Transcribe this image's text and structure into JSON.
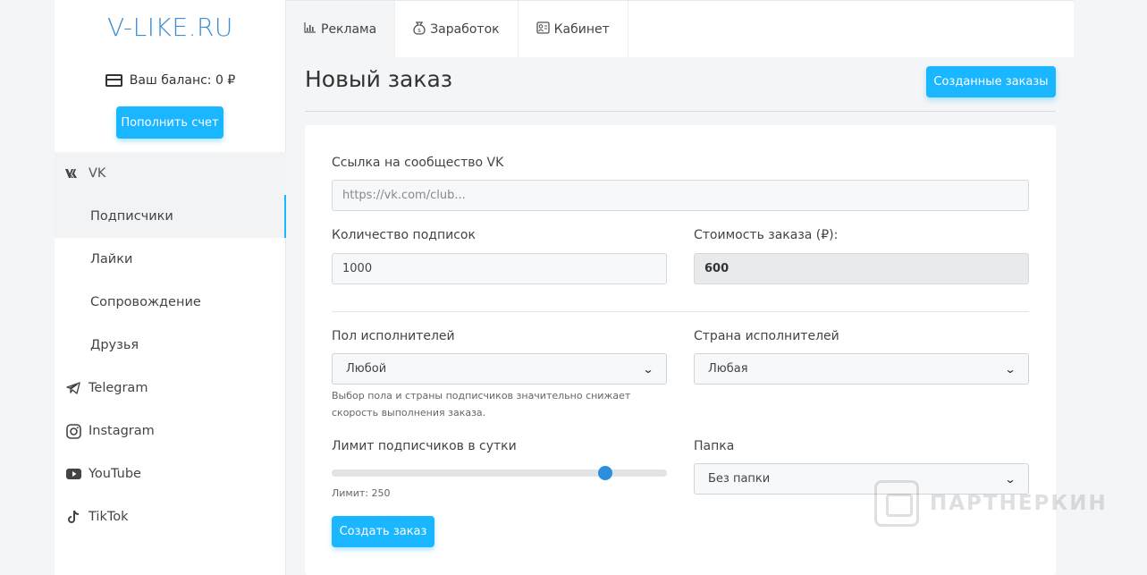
{
  "brand": {
    "logo": "V-LIKE.RU",
    "color": "#3e8ed0",
    "accent": "#1ab6ff"
  },
  "sidebar": {
    "balance_label": "Ваш баланс: 0 ₽",
    "balance_icon": "credit-card-icon",
    "topup_label": "Пополнить счет",
    "items": [
      {
        "label": "VK",
        "icon": "vk-icon",
        "type": "section"
      },
      {
        "label": "Подписчики",
        "type": "sub",
        "active": true
      },
      {
        "label": "Лайки",
        "type": "sub"
      },
      {
        "label": "Сопровождение",
        "type": "sub"
      },
      {
        "label": "Друзья",
        "type": "sub"
      },
      {
        "label": "Telegram",
        "icon": "telegram-icon",
        "type": "section"
      },
      {
        "label": "Instagram",
        "icon": "instagram-icon",
        "type": "section"
      },
      {
        "label": "YouTube",
        "icon": "youtube-icon",
        "type": "section"
      },
      {
        "label": "TikTok",
        "icon": "tiktok-icon",
        "type": "section"
      }
    ]
  },
  "topbar": {
    "tabs": [
      {
        "label": "Реклама",
        "icon": "bar-chart-icon",
        "active": true
      },
      {
        "label": "Заработок",
        "icon": "money-bag-icon"
      },
      {
        "label": "Кабинет",
        "icon": "cabinet-icon"
      }
    ]
  },
  "page": {
    "title": "Новый заказ",
    "orders_button": "Созданные заказы"
  },
  "form": {
    "link_label": "Ссылка на сообщество VK",
    "link_placeholder": "https://vk.com/club...",
    "link_value": "",
    "count_label": "Количество подписок",
    "count_value": "1000",
    "cost_label": "Стоимость заказа (₽):",
    "cost_value": "600",
    "gender_label": "Пол исполнителей",
    "gender_value": "Любой",
    "country_label": "Страна исполнителей",
    "country_value": "Любая",
    "hint": "Выбор пола и страны подписчиков значительно снижает скорость выполнения заказа.",
    "limit_label": "Лимит подписчиков в сутки",
    "limit_text": "Лимит: 250",
    "limit_fraction": 0.815,
    "folder_label": "Папка",
    "folder_value": "Без папки",
    "submit_label": "Создать заказ"
  },
  "watermark": {
    "text": "ПАРТНЕРКИН"
  }
}
